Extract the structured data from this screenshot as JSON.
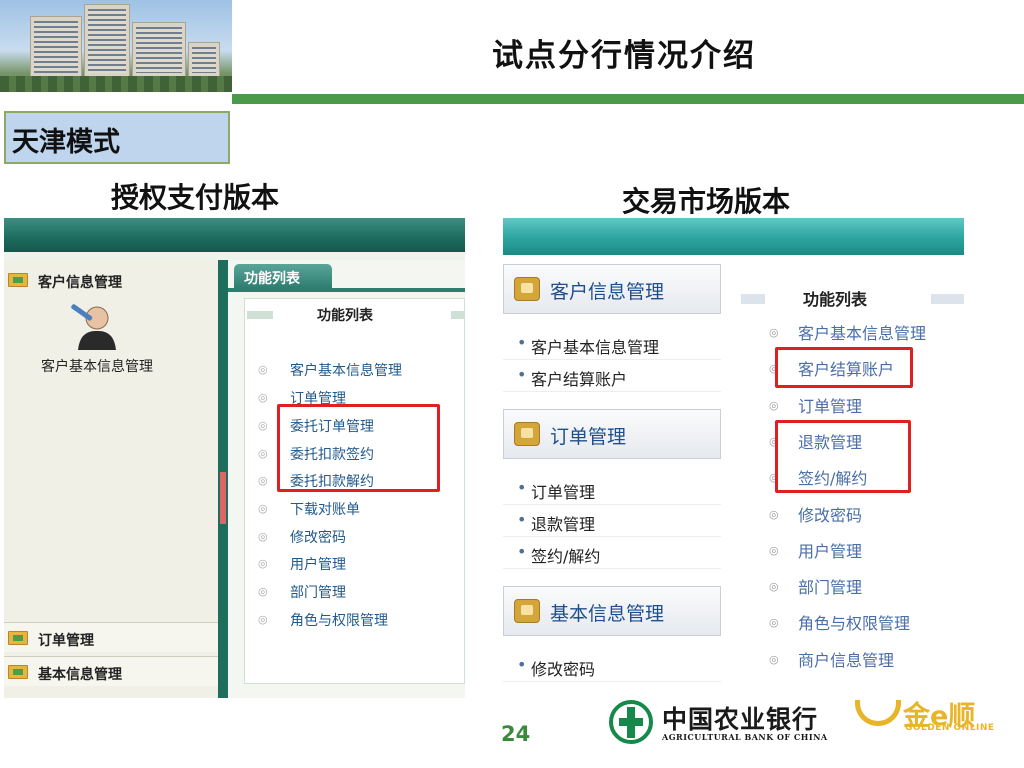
{
  "header": {
    "title": "试点分行情况介绍"
  },
  "mode_label": "天津模式",
  "left": {
    "heading": "授权支付版本",
    "sidebar": {
      "header": "客户信息管理",
      "user_label": "客户基本信息管理",
      "groups": [
        "订单管理",
        "基本信息管理"
      ]
    },
    "tab_label": "功能列表",
    "panel_title": "功能列表",
    "items": [
      "客户基本信息管理",
      "订单管理",
      "委托订单管理",
      "委托扣款签约",
      "委托扣款解约",
      "下载对账单",
      "修改密码",
      "用户管理",
      "部门管理",
      "角色与权限管理"
    ]
  },
  "right": {
    "heading": "交易市场版本",
    "groups": [
      {
        "label": "客户信息管理",
        "items": [
          "客户基本信息管理",
          "客户结算账户"
        ]
      },
      {
        "label": "订单管理",
        "items": [
          "订单管理",
          "退款管理",
          "签约/解约"
        ]
      },
      {
        "label": "基本信息管理",
        "items": [
          "修改密码"
        ]
      }
    ],
    "panel_title": "功能列表",
    "items": [
      "客户基本信息管理",
      "客户结算账户",
      "订单管理",
      "退款管理",
      "签约/解约",
      "修改密码",
      "用户管理",
      "部门管理",
      "角色与权限管理",
      "商户信息管理"
    ]
  },
  "footer": {
    "page_number": "24",
    "bank_name": "中国农业银行",
    "bank_name_en": "AGRICULTURAL BANK OF CHINA",
    "partner_name": "金e顺",
    "partner_name_en": "GOLDEN ONLINE"
  },
  "colors": {
    "accent_green": "#4a9a4a",
    "highlight_red": "#e02020",
    "link_blue": "#225a8c",
    "teal": "#2fa7a2"
  }
}
